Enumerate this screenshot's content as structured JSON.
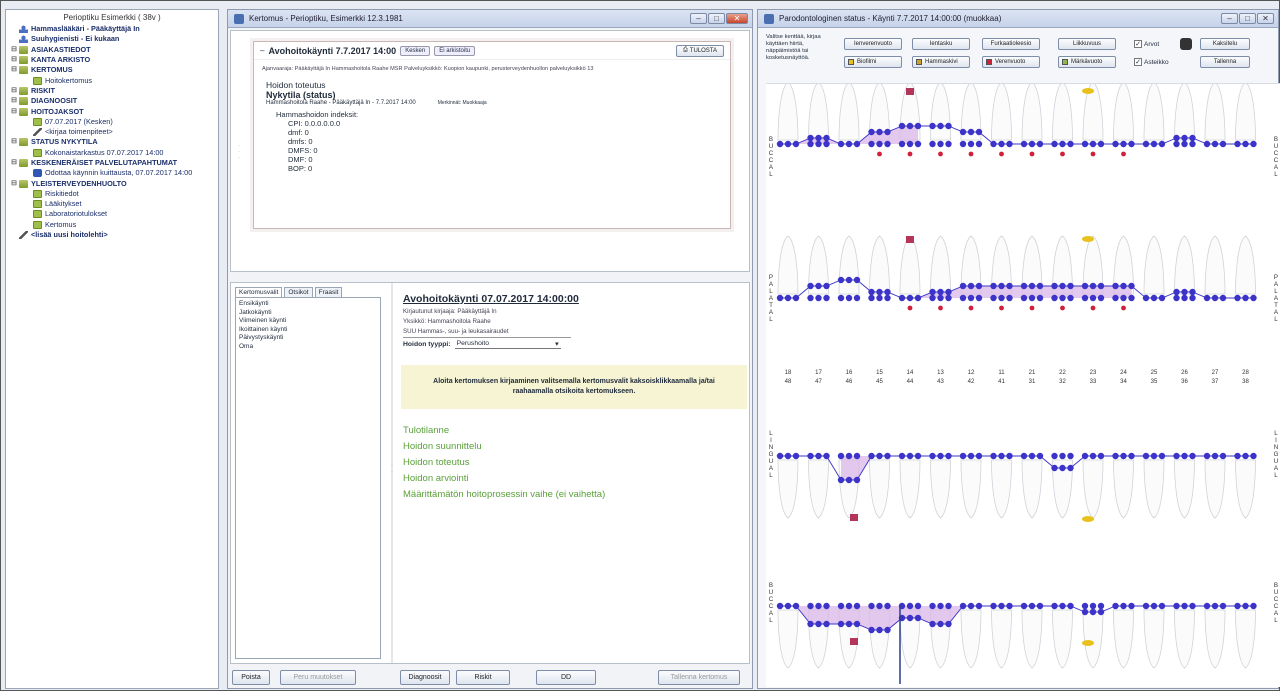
{
  "tree": {
    "title": "Perioptiku Esimerkki ( 38v )",
    "items": [
      {
        "label": "Hammaslääkäri - Pääkäyttäjä In",
        "icon": "user-icon",
        "indent": 0,
        "bold": true
      },
      {
        "label": "Suuhygienisti - Ei kukaan",
        "icon": "user-icon",
        "indent": 0,
        "bold": true
      },
      {
        "label": "ASIAKASTIEDOT",
        "icon": "folder-icon",
        "indent": 0,
        "bold": true
      },
      {
        "label": "KANTA ARKISTO",
        "icon": "folder-icon",
        "indent": 0,
        "bold": true
      },
      {
        "label": "KERTOMUS",
        "icon": "folder-icon",
        "indent": 0,
        "bold": true
      },
      {
        "label": "Hoitokertomus",
        "icon": "document-icon",
        "indent": 2,
        "bold": false
      },
      {
        "label": "RISKIT",
        "icon": "folder-icon",
        "indent": 0,
        "bold": true
      },
      {
        "label": "DIAGNOOSIT",
        "icon": "folder-icon",
        "indent": 0,
        "bold": true
      },
      {
        "label": "HOITOJAKSOT",
        "icon": "folder-icon",
        "indent": 0,
        "bold": true
      },
      {
        "label": "07.07.2017 (Kesken)",
        "icon": "document-icon",
        "indent": 2,
        "bold": false
      },
      {
        "label": "<kirjaa toimenpiteet>",
        "icon": "pen-icon",
        "indent": 2,
        "bold": false
      },
      {
        "label": "STATUS NYKYTILA",
        "icon": "folder-icon",
        "indent": 0,
        "bold": true
      },
      {
        "label": "Kokonaistarkastus 07.07.2017 14:00",
        "icon": "document-icon",
        "indent": 2,
        "bold": false
      },
      {
        "label": "KESKENERÄISET PALVELUTAPAHTUMAT",
        "icon": "folder-icon",
        "indent": 0,
        "bold": true
      },
      {
        "label": "Odottaa käynnin kuittausta, 07.07.2017 14:00",
        "icon": "square-icon",
        "indent": 2,
        "bold": false
      },
      {
        "label": "YLEISTERVEYDENHUOLTO",
        "icon": "folder-icon",
        "indent": 0,
        "bold": true
      },
      {
        "label": "Riskitiedot",
        "icon": "document-icon",
        "indent": 2,
        "bold": false
      },
      {
        "label": "Lääkitykset",
        "icon": "document-icon",
        "indent": 2,
        "bold": false
      },
      {
        "label": "Laboratoriotulokset",
        "icon": "document-icon",
        "indent": 2,
        "bold": false
      },
      {
        "label": "Kertomus",
        "icon": "document-icon",
        "indent": 2,
        "bold": false
      },
      {
        "label": "<lisää uusi hoitolehti>",
        "icon": "pen-icon",
        "indent": 0,
        "bold": true
      }
    ]
  },
  "kertomus_window": {
    "title": "Kertomus - Perioptiku, Esimerkki 12.3.1981",
    "visit_card": {
      "title": "Avohoitokäynti 7.7.2017 14:00",
      "chip1": "Kesken",
      "chip2": "Ei arkistoitu",
      "print_button": "TULOSTA",
      "meta_line": "Ajanvaaraja: Pääkäyttäjä In Hammashoitola Raahe MSR     Palveluyksikkö: Kuopion kaupunki, perusterveydenhuollon palveluyksikkö 13",
      "section": "Hoidon toteutus",
      "status_heading": "Nykytila (status)",
      "author_line": "Hammashoitola Raahe - Pääkäyttäjä In - 7.7.2017 14:00",
      "author_extra": "Merkinnät: Muokkaaja",
      "indices_heading": "Hammashoidon indeksit:",
      "indices": [
        "CPI: 0.0.0.0.0.0",
        "dmf: 0",
        "dmfs: 0",
        "DMFS: 0",
        "DMF: 0",
        "BOP: 0"
      ]
    },
    "tabs": [
      "Kertomusvalit",
      "Otsikot",
      "Fraasit"
    ],
    "list_items": [
      "Ensikäynti",
      "Jatkokäynti",
      "Viimeinen käynti",
      "Ikoittainen käynti",
      "Päivystyskäynti",
      "Oma"
    ],
    "entry": {
      "title": "Avohoitokäynti 07.07.2017 14:00:00",
      "line1": "Kirjautunut kirjaaja: Pääkäyttäjä In",
      "line2": "Yksikkö: Hammashoitola Raahe",
      "line3": "SUU Hammas-, suu- ja leukasairaudet",
      "hoidon_tyyppi_label": "Hoidon tyyppi:",
      "hoidon_tyyppi_value": "Perushoito",
      "notice": "Aloita kertomuksen kirjaaminen valitsemalla kertomusvalit kaksoisklikkaamalla ja/tai raahaamalla otsikoita kertomukseen.",
      "headings": [
        "Tulotilanne",
        "Hoidon suunnittelu",
        "Hoidon toteutus",
        "Hoidon arviointi",
        "Määrittämätön hoitoprosessin vaihe (ei vaihetta)"
      ]
    },
    "buttons": {
      "poista": "Poista",
      "peru": "Peru muutokset",
      "diagnoosit": "Diagnoosit",
      "riskit": "Riskit",
      "dd": "DD",
      "tallenna": "Tallenna kertomus"
    }
  },
  "status_window": {
    "title": "Parodontologinen status - Käynti 7.7.2017 14:00:00 (muokkaa)",
    "instructions": "Valitse kenttää, kirjaa käyttäen hiirtä, näppäimistöä tai kosketusnäyttöä.",
    "buttons": [
      "Ienverenvuoto",
      "Ientasku",
      "Furkaatioleesio",
      "Liikkuvuus"
    ],
    "chips": [
      "Biofilmi",
      "Hammaskivi",
      "Verenvuoto",
      "Märkävuoto"
    ],
    "checks": [
      "Arvot",
      "Asteikko"
    ],
    "action_buttons": [
      "Kaksitelu",
      "Tallenna"
    ],
    "side_labels": {
      "buccal": "BUCCAL",
      "palatal": "PALATAL",
      "lingual": "LINGUAL"
    },
    "upper_numbers": [
      "18",
      "17",
      "16",
      "15",
      "14",
      "13",
      "12",
      "11",
      "21",
      "22",
      "23",
      "24",
      "25",
      "26",
      "27",
      "28"
    ],
    "lower_numbers": [
      "48",
      "47",
      "46",
      "45",
      "44",
      "43",
      "42",
      "41",
      "31",
      "32",
      "33",
      "34",
      "35",
      "36",
      "37",
      "38"
    ]
  },
  "colors": {
    "accent_blue": "#3c33c8",
    "pocket_fill": "#d9b7e8",
    "bleeding_red": "#d0203a",
    "marker_yellow": "#e8c21a",
    "link_green": "#5a9f3a"
  }
}
